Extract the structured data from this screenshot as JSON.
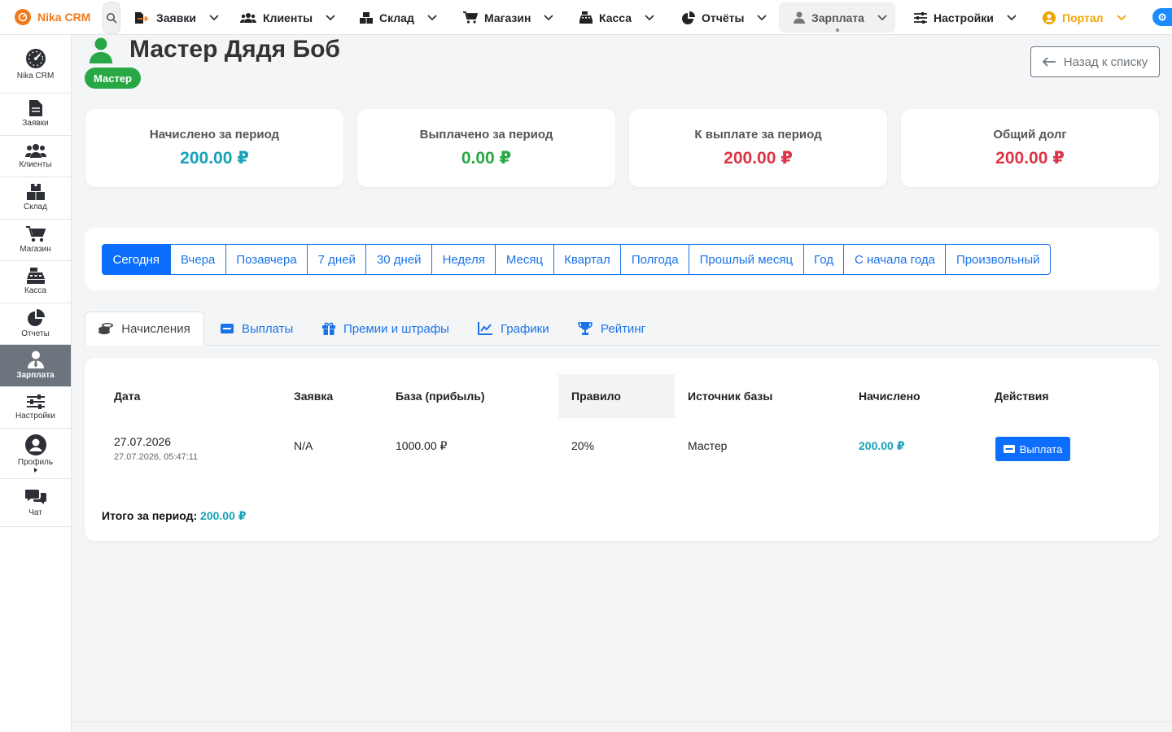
{
  "nav": {
    "brand": "Nika CRM",
    "items": [
      {
        "label": "Заявки"
      },
      {
        "label": "Клиенты"
      },
      {
        "label": "Склад"
      },
      {
        "label": "Магазин"
      },
      {
        "label": "Касса"
      },
      {
        "label": "Отчёты"
      },
      {
        "label": "Зарплата"
      },
      {
        "label": "Настройки"
      },
      {
        "label": "Портал"
      }
    ]
  },
  "sidebar": {
    "items": [
      {
        "label": "Nika CRM"
      },
      {
        "label": "Заявки"
      },
      {
        "label": "Клиенты"
      },
      {
        "label": "Склад"
      },
      {
        "label": "Магазин"
      },
      {
        "label": "Касса"
      },
      {
        "label": "Отчеты"
      },
      {
        "label": "Зарплата"
      },
      {
        "label": "Настройки"
      },
      {
        "label": "Профиль"
      },
      {
        "label": "Чат"
      }
    ]
  },
  "page": {
    "title": "Мастер Дядя Боб",
    "role_badge": "Мастер",
    "back_label": "Назад к списку"
  },
  "stats": [
    {
      "label": "Начислено за период",
      "value": "200.00 ₽",
      "color": "#17a2b8"
    },
    {
      "label": "Выплачено за период",
      "value": "0.00 ₽",
      "color": "#28a745"
    },
    {
      "label": "К выплате за период",
      "value": "200.00 ₽",
      "color": "#dc3545"
    },
    {
      "label": "Общий долг",
      "value": "200.00 ₽",
      "color": "#dc3545"
    }
  ],
  "periods": [
    "Сегодня",
    "Вчера",
    "Позавчера",
    "7 дней",
    "30 дней",
    "Неделя",
    "Месяц",
    "Квартал",
    "Полгода",
    "Прошлый месяц",
    "Год",
    "С начала года",
    "Произвольный"
  ],
  "tabs": [
    {
      "label": "Начисления"
    },
    {
      "label": "Выплаты"
    },
    {
      "label": "Премии и штрафы"
    },
    {
      "label": "Графики"
    },
    {
      "label": "Рейтинг"
    }
  ],
  "table": {
    "headers": {
      "date": "Дата",
      "order": "Заявка",
      "base": "База (прибыль)",
      "rule": "Правило",
      "source": "Источник базы",
      "accrued": "Начислено",
      "actions": "Действия"
    },
    "rows": [
      {
        "date": "27.07.2026",
        "datetime": "27.07.2026, 05:47:11",
        "order": "N/A",
        "base": "1000.00 ₽",
        "rule": "20%",
        "source": "Мастер",
        "accrued": "200.00 ₽",
        "action_label": "Выплата"
      }
    ],
    "total_label": "Итого за период:",
    "total_value": "200.00 ₽"
  }
}
